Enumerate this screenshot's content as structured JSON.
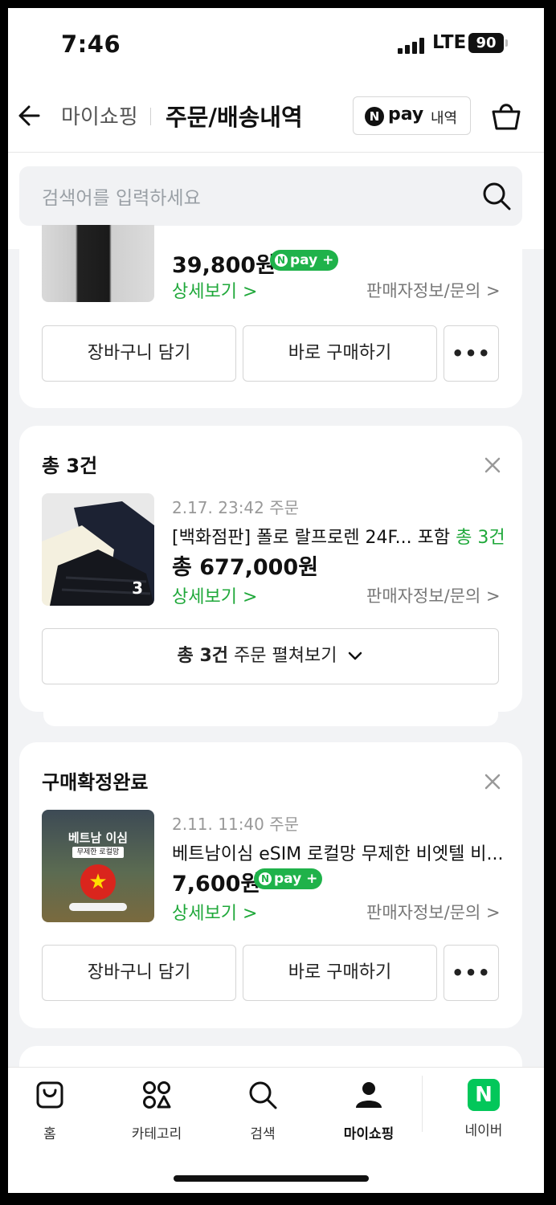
{
  "status_bar": {
    "time": "7:46",
    "network": "LTE",
    "battery": "90"
  },
  "header": {
    "breadcrumb": "마이쇼핑",
    "title": "주문/배송내역",
    "npay_button": {
      "brand_letter": "N",
      "brand": "pay",
      "label": "내역"
    }
  },
  "search": {
    "placeholder": "검색어를 입력하세요"
  },
  "order_card_1": {
    "price": "39,800원",
    "npay_badge": "pay",
    "detail_link": "상세보기 >",
    "seller_link": "판매자정보/문의 >",
    "cart_button": "장바구니 담기",
    "buy_button": "바로 구매하기",
    "more_button": "•••"
  },
  "order_card_2": {
    "title": "총 3건",
    "date": "2.17. 23:42 주문",
    "product_name": "[백화점판] 폴로 랄프로렌 24F... 포함",
    "product_count": "총 3건",
    "price": "총 677,000원",
    "thumb_count": "3",
    "detail_link": "상세보기 >",
    "seller_link": "판매자정보/문의 >",
    "expand_button": {
      "count": "총 3건",
      "label": "주문 펼쳐보기"
    }
  },
  "order_card_3": {
    "title": "구매확정완료",
    "date": "2.11. 11:40 주문",
    "product_name": "베트남이심 eSIM 로컬망 무제한 비엣텔 비...",
    "price": "7,600원",
    "npay_badge": "pay",
    "detail_link": "상세보기 >",
    "seller_link": "판매자정보/문의 >",
    "cart_button": "장바구니 담기",
    "buy_button": "바로 구매하기",
    "more_button": "•••",
    "thumb_text": {
      "line1": "베트남 이심",
      "line2": "무제한 로컬망"
    }
  },
  "bottom_nav": {
    "items": [
      {
        "label": "홈",
        "icon": "bag-icon"
      },
      {
        "label": "카테고리",
        "icon": "category-icon"
      },
      {
        "label": "검색",
        "icon": "search-icon"
      },
      {
        "label": "마이쇼핑",
        "icon": "person-icon",
        "active": true
      },
      {
        "label": "네이버",
        "icon": "naver-logo-icon"
      }
    ]
  },
  "colors": {
    "accent_green": "#1fa83a",
    "npay_green": "#1fb24a",
    "naver_green": "#03c75a"
  }
}
